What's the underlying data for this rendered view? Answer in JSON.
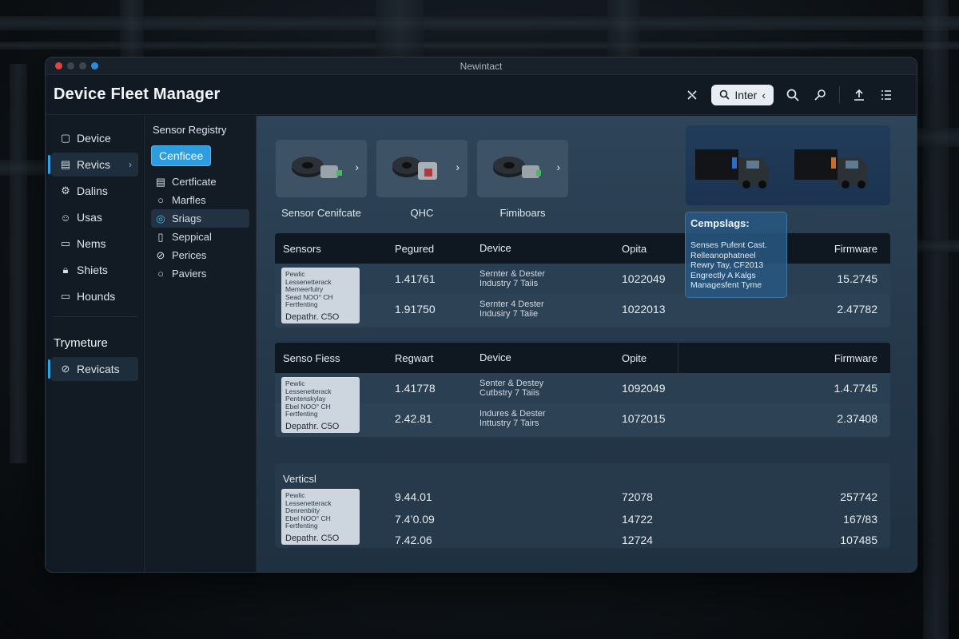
{
  "window": {
    "title": "Newintact"
  },
  "app": {
    "title": "Device Fleet Manager"
  },
  "toolbar": {
    "search_label": "Inter"
  },
  "sidebar": {
    "items": [
      {
        "label": "Device",
        "icon": "device-icon"
      },
      {
        "label": "Revics",
        "icon": "list-icon"
      },
      {
        "label": "Dalins",
        "icon": "gear-icon"
      },
      {
        "label": "Usas",
        "icon": "user-icon"
      },
      {
        "label": "Nems",
        "icon": "chat-icon"
      },
      {
        "label": "Shiets",
        "icon": "lock-icon"
      },
      {
        "label": "Hounds",
        "icon": "monitor-icon"
      }
    ],
    "section_title": "Trymeture",
    "section_item": "Revicats"
  },
  "subnav": {
    "title": "Sensor Registry",
    "button": "Cenficee",
    "items": [
      "Certficate",
      "Marfles",
      "Sriags",
      "Seppical",
      "Perices",
      "Paviers"
    ]
  },
  "cards": [
    {
      "label": "Sensor Cenifcate"
    },
    {
      "label": "QHC"
    },
    {
      "label": "Fimiboars"
    }
  ],
  "popup": {
    "title": "Cempslags:",
    "lines": [
      "Senses Pufent Cast.",
      "Relleanophatneel",
      "Rewry Tay, CF2013",
      "Engrectly A Kalgs",
      "Managesfent Tyme"
    ]
  },
  "table1": {
    "headers": [
      "Sensors",
      "Pegured",
      "Device",
      "Opita",
      "Firmware"
    ],
    "chip": {
      "lines": [
        "Pewlic",
        "Lessenetterack",
        "Memeerfulry",
        "Sead  NOO° CH",
        "Fertfenting"
      ],
      "big": "Depathr. C5O"
    },
    "rows": [
      {
        "c2": "1.41761",
        "dev1": "Sernter & Dester",
        "dev2": "Industry 7 Taiis",
        "c4": "1022049",
        "c6": "15.2745"
      },
      {
        "c2": "1.91750",
        "dev1": "Sernter 4 Dester",
        "dev2": "Indusiry 7 Taiie",
        "c4": "1022013",
        "c6": "2.47782"
      }
    ]
  },
  "table2": {
    "headers": [
      "Senso Fiess",
      "Regwart",
      "Device",
      "Opite",
      "Firmware"
    ],
    "chip": {
      "lines": [
        "Pewlic",
        "Lessenetterack",
        "Pentenskylay",
        "Ebel  NOO° CH",
        "Fertfenting"
      ],
      "big": "Depathr. C5O"
    },
    "rows": [
      {
        "c2": "1.41778",
        "dev1": "Senter & Destey",
        "dev2": "Cutbstry 7 Taiis",
        "c4": "1092049",
        "c6": "1.4.7745"
      },
      {
        "c2": "2.42.81",
        "dev1": "Indures & Dester",
        "dev2": "Inttustry 7 Tairs",
        "c4": "1072015",
        "c6": "2.37408"
      }
    ]
  },
  "table3": {
    "title": "Verticsl",
    "chip": {
      "lines": [
        "Pewlic",
        "Lessenetterack",
        "Denrenbiity",
        "Ebel  NOO° CH",
        "Fertfenting"
      ],
      "big": "Depathr. C5O"
    },
    "rows": [
      {
        "c2": "9.44.01",
        "c4": "72078",
        "c6": "257742"
      },
      {
        "c2": "7.4’0.09",
        "c4": "14722",
        "c6": "167/83"
      },
      {
        "c2": "7.42.06",
        "c4": "12724",
        "c6": "107485"
      }
    ]
  },
  "colors": {
    "accent": "#2aa4e6",
    "close": "#e0443e",
    "minimize": "#3a4650",
    "zoom": "#2e8bd8"
  }
}
